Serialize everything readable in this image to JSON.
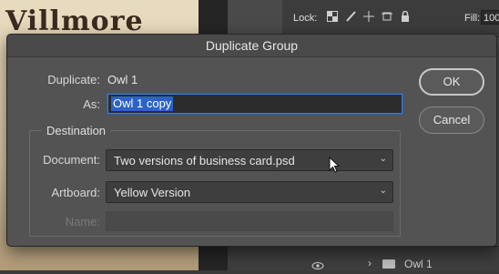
{
  "background": {
    "canvas_title": "Villmore",
    "lock_label": "Lock:",
    "fill_label": "Fill:",
    "fill_value": "100",
    "layer_name": "Owl 1"
  },
  "dialog": {
    "title": "Duplicate Group",
    "duplicate_label": "Duplicate:",
    "duplicate_value": "Owl 1",
    "as_label": "As:",
    "as_value": "Owl 1 copy",
    "destination_label": "Destination",
    "document_label": "Document:",
    "document_value": "Two versions of business card.psd",
    "artboard_label": "Artboard:",
    "artboard_value": "Yellow Version",
    "name_label": "Name:",
    "name_value": "",
    "ok_label": "OK",
    "cancel_label": "Cancel"
  },
  "colors": {
    "dialog_bg": "#535353",
    "selection": "#2d63c8",
    "focus_ring": "#3d7fcf"
  },
  "icons": [
    "lock-transparent-icon",
    "lock-paint-icon",
    "lock-move-icon",
    "lock-artboard-icon",
    "lock-all-icon",
    "eye-icon",
    "chevron-right-icon",
    "folder-icon",
    "chevron-down-icon",
    "mouse-cursor-icon"
  ]
}
